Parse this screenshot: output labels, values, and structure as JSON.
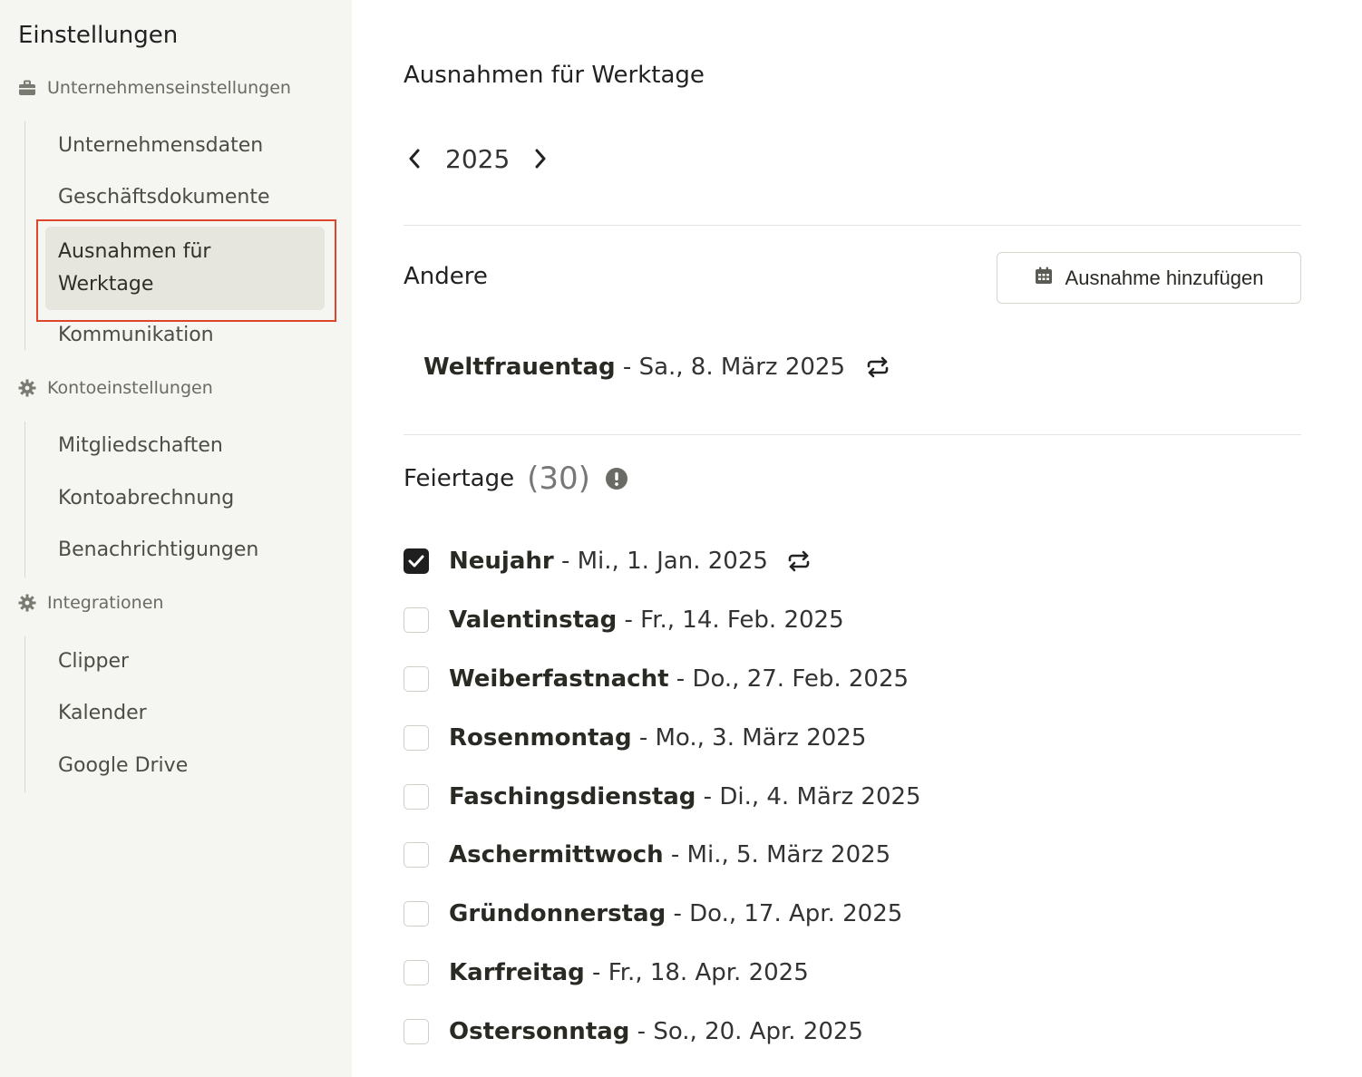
{
  "sidebar": {
    "title": "Einstellungen",
    "sections": [
      {
        "label": "Unternehmenseinstellungen",
        "icon": "briefcase-icon",
        "items": [
          "Unternehmensdaten",
          "Geschäftsdokumente",
          "Ausnahmen für Werktage",
          "Kommunikation"
        ]
      },
      {
        "label": "Kontoeinstellungen",
        "icon": "gear-icon",
        "items": [
          "Mitgliedschaften",
          "Kontoabrechnung",
          "Benachrichtigungen"
        ]
      },
      {
        "label": "Integrationen",
        "icon": "gear-icon",
        "items": [
          "Clipper",
          "Kalender",
          "Google Drive"
        ]
      }
    ],
    "active_item": "Ausnahmen für Werktage",
    "highlight_color": "#e0452b"
  },
  "main": {
    "title": "Ausnahmen für Werktage",
    "year": "2025",
    "other": {
      "title": "Andere",
      "add_button_label": "Ausnahme hinzufügen",
      "exceptions": [
        {
          "name": "Weltfrauentag",
          "date": " - Sa., 8. März 2025",
          "recurring": true
        }
      ]
    },
    "holidays": {
      "title": "Feiertage",
      "count": "(30)",
      "items": [
        {
          "name": "Neujahr",
          "date": " - Mi., 1. Jan. 2025",
          "checked": true,
          "recurring": true
        },
        {
          "name": "Valentinstag",
          "date": " - Fr., 14. Feb. 2025",
          "checked": false
        },
        {
          "name": "Weiberfastnacht",
          "date": " - Do., 27. Feb. 2025",
          "checked": false
        },
        {
          "name": "Rosenmontag",
          "date": " - Mo., 3. März 2025",
          "checked": false
        },
        {
          "name": "Faschingsdienstag",
          "date": " - Di., 4. März 2025",
          "checked": false
        },
        {
          "name": "Aschermittwoch",
          "date": " - Mi., 5. März 2025",
          "checked": false
        },
        {
          "name": "Gründonnerstag",
          "date": " - Do., 17. Apr. 2025",
          "checked": false
        },
        {
          "name": "Karfreitag",
          "date": " - Fr., 18. Apr. 2025",
          "checked": false
        },
        {
          "name": "Ostersonntag",
          "date": " - So., 20. Apr. 2025",
          "checked": false
        }
      ]
    }
  }
}
